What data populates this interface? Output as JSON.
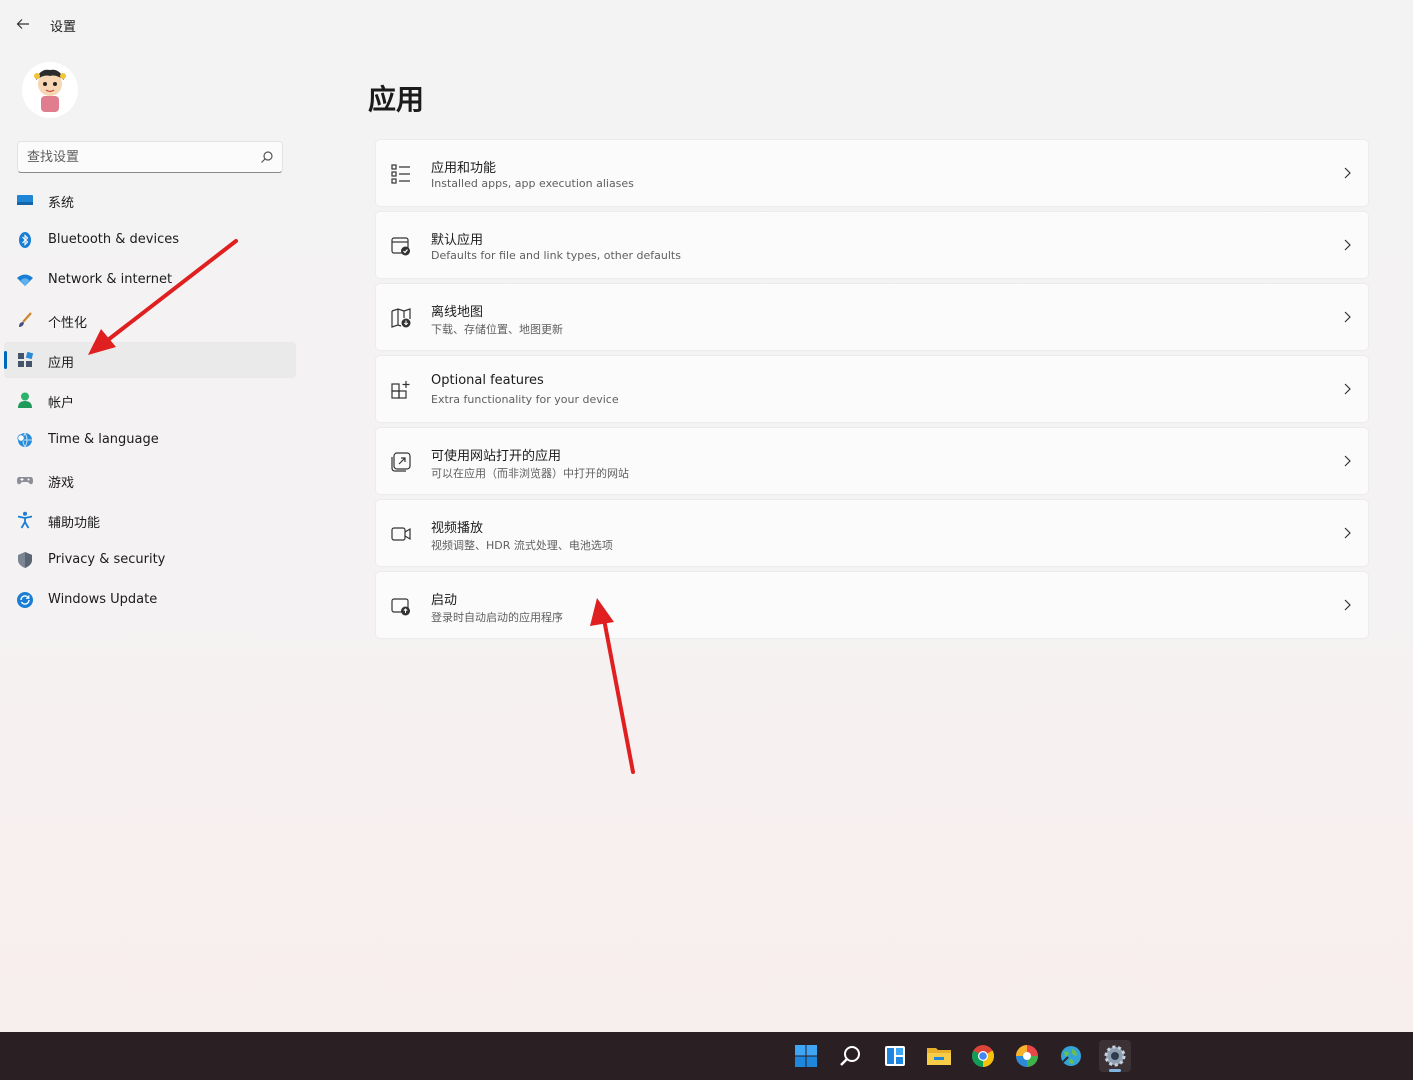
{
  "window": {
    "title": "设置"
  },
  "search": {
    "placeholder": "查找设置"
  },
  "sidebar": {
    "items": [
      {
        "label": "系统",
        "icon": "system-icon"
      },
      {
        "label": "Bluetooth & devices",
        "icon": "bluetooth-icon"
      },
      {
        "label": "Network & internet",
        "icon": "wifi-icon"
      },
      {
        "label": "个性化",
        "icon": "brush-icon"
      },
      {
        "label": "应用",
        "icon": "apps-icon",
        "active": true
      },
      {
        "label": "帐户",
        "icon": "account-icon"
      },
      {
        "label": "Time & language",
        "icon": "globe-clock-icon"
      },
      {
        "label": "游戏",
        "icon": "gamepad-icon"
      },
      {
        "label": "辅助功能",
        "icon": "accessibility-icon"
      },
      {
        "label": "Privacy & security",
        "icon": "shield-icon"
      },
      {
        "label": "Windows Update",
        "icon": "update-icon"
      }
    ]
  },
  "main": {
    "title": "应用",
    "cards": [
      {
        "title": "应用和功能",
        "subtitle": "Installed apps, app execution aliases",
        "icon": "list-icon"
      },
      {
        "title": "默认应用",
        "subtitle": "Defaults for file and link types, other defaults",
        "icon": "default-apps-icon"
      },
      {
        "title": "离线地图",
        "subtitle": "下载、存储位置、地图更新",
        "icon": "map-icon"
      },
      {
        "title": "Optional features",
        "subtitle": "Extra functionality for your device",
        "icon": "add-grid-icon"
      },
      {
        "title": "可使用网站打开的应用",
        "subtitle": "可以在应用（而非浏览器）中打开的网站",
        "icon": "open-external-icon"
      },
      {
        "title": "视频播放",
        "subtitle": "视频调整、HDR 流式处理、电池选项",
        "icon": "video-icon"
      },
      {
        "title": "启动",
        "subtitle": "登录时自动启动的应用程序",
        "icon": "startup-icon"
      }
    ]
  },
  "taskbar": {
    "icons": [
      "windows-start-icon",
      "search-icon",
      "widgets-icon",
      "file-explorer-icon",
      "chrome-icon",
      "color-app-icon",
      "network-globe-icon",
      "settings-icon"
    ]
  },
  "colors": {
    "accent": "#0067c0",
    "annotation": "#e02020",
    "taskbar": "#2a1f23"
  }
}
